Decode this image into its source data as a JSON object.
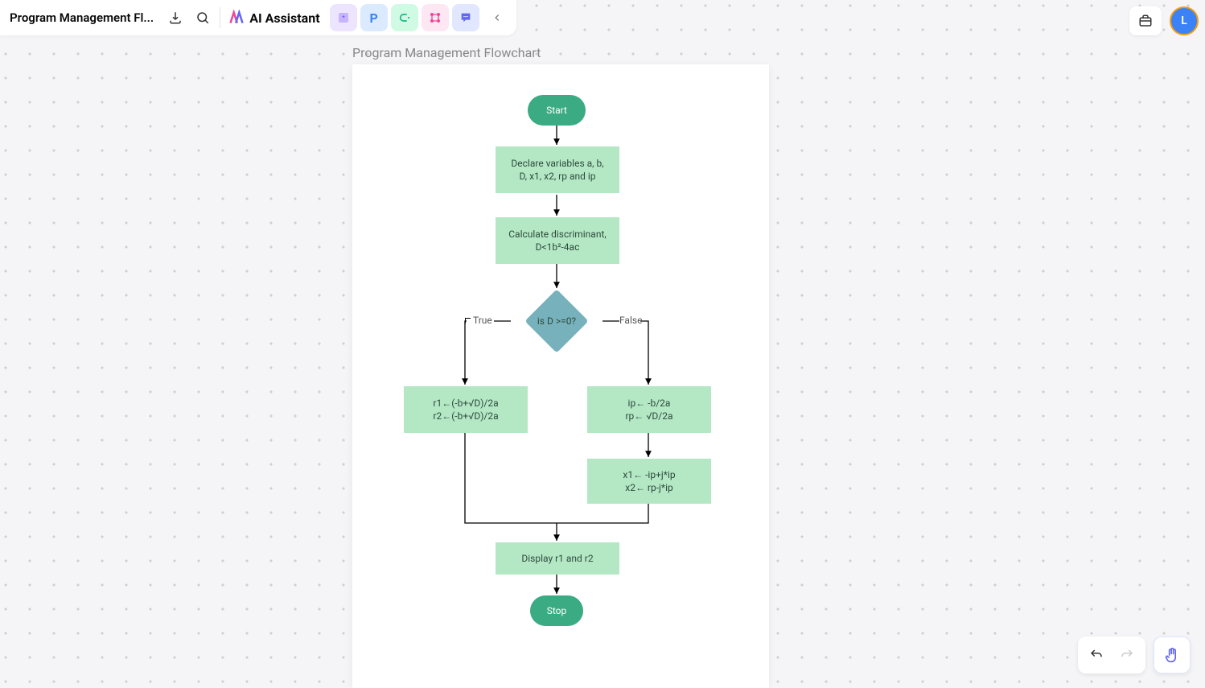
{
  "doc": {
    "title": "Program Management Fl..."
  },
  "toolbar": {
    "ai_label": "AI Assistant",
    "chips": [
      "✦",
      "P",
      "⊂",
      "⊹",
      "💬"
    ]
  },
  "user": {
    "initial": "L"
  },
  "canvas": {
    "page_title": "Program Management Flowchart"
  },
  "flowchart": {
    "start": "Start",
    "stop": "Stop",
    "declare_l1": "Declare variables a, b,",
    "declare_l2": "D, x1, x2, rp and ip",
    "calc_l1": "Calculate discriminant,",
    "calc_l2": "D<1b²-4ac",
    "decision": "is D >=0?",
    "true_label": "True",
    "false_label": "False",
    "left_l1": "r1←(-b+√D)/2a",
    "left_l2": "r2←(-b+√D)/2a",
    "right1_l1": "ip← -b/2a",
    "right1_l2": "rp← √D/2a",
    "right2_l1": "x1← -ip+j*ip",
    "right2_l2": "x2← rp-j*ip",
    "display": "Display r1 and r2"
  }
}
